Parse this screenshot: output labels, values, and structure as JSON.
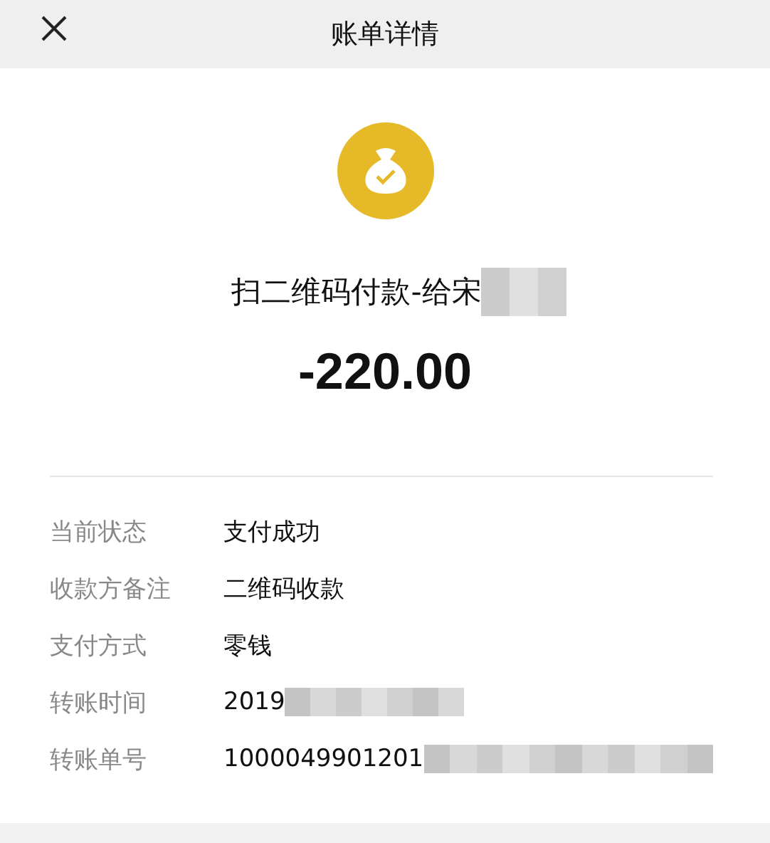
{
  "header": {
    "title": "账单详情"
  },
  "summary": {
    "title": "扫二维码付款-给宋",
    "title_redacted": true,
    "amount": "-220.00"
  },
  "details": [
    {
      "label": "当前状态",
      "value": "支付成功",
      "redacted": false
    },
    {
      "label": "收款方备注",
      "value": "二维码收款",
      "redacted": false
    },
    {
      "label": "支付方式",
      "value": "零钱",
      "redacted": false
    },
    {
      "label": "转账时间",
      "value": "2019",
      "redacted": true
    },
    {
      "label": "转账单号",
      "value": "1000049901201",
      "redacted": true
    }
  ]
}
